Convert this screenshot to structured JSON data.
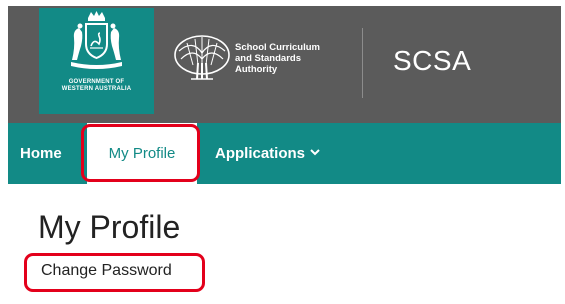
{
  "header": {
    "government_lines": [
      "GOVERNMENT OF",
      "WESTERN AUSTRALIA"
    ],
    "org_lines": [
      "School Curriculum",
      "and Standards",
      "Authority"
    ],
    "acronym": "SCSA",
    "colors": {
      "header_bg": "#5b5b5b",
      "brand_teal": "#128a86"
    },
    "icons": [
      "wa-coat-of-arms-icon",
      "scsa-tree-emblem-icon"
    ]
  },
  "nav": {
    "items": [
      {
        "label": "Home",
        "active": false
      },
      {
        "label": "My Profile",
        "active": true
      },
      {
        "label": "Applications",
        "active": false,
        "icon": "chevron-down-icon"
      }
    ]
  },
  "main": {
    "title": "My Profile",
    "change_password_label": "Change Password"
  },
  "highlight_color": "#e3001b"
}
